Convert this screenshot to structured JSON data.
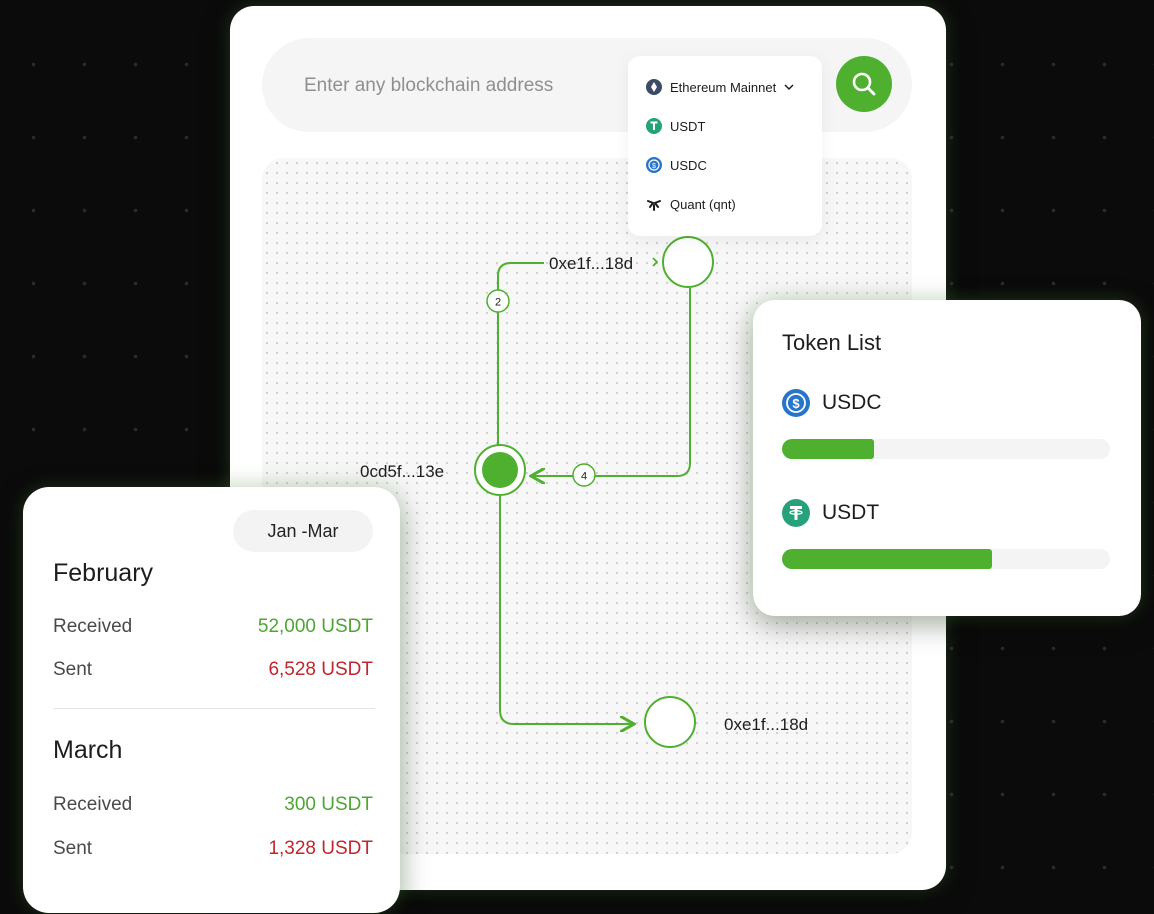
{
  "search": {
    "placeholder": "Enter any blockchain address",
    "network_selected": "Ethereum Mainnet",
    "network_options": [
      "USDT",
      "USDC",
      "Quant (qnt)"
    ]
  },
  "graph": {
    "center_address": "0cd5f...13e",
    "top_address": "0xe1f...18d",
    "bottom_address": "0xe1f...18d",
    "edge_count_top": "2",
    "edge_count_right": "4"
  },
  "summary": {
    "period": "Jan -Mar",
    "months": [
      {
        "name": "February",
        "received_label": "Received",
        "received": "52,000 USDT",
        "sent_label": "Sent",
        "sent": "6,528 USDT"
      },
      {
        "name": "March",
        "received_label": "Received",
        "received": "300 USDT",
        "sent_label": "Sent",
        "sent": "1,328 USDT"
      }
    ]
  },
  "token_list": {
    "title": "Token List",
    "tokens": [
      {
        "name": "USDC",
        "fraction": 0.28,
        "icon": "usdc-icon"
      },
      {
        "name": "USDT",
        "fraction": 0.64,
        "icon": "usdt-icon"
      }
    ]
  },
  "colors": {
    "accent": "#4fb030",
    "received": "#4fa532",
    "sent": "#c0262b",
    "usdc": "#2775ca",
    "usdt": "#26a17b"
  }
}
